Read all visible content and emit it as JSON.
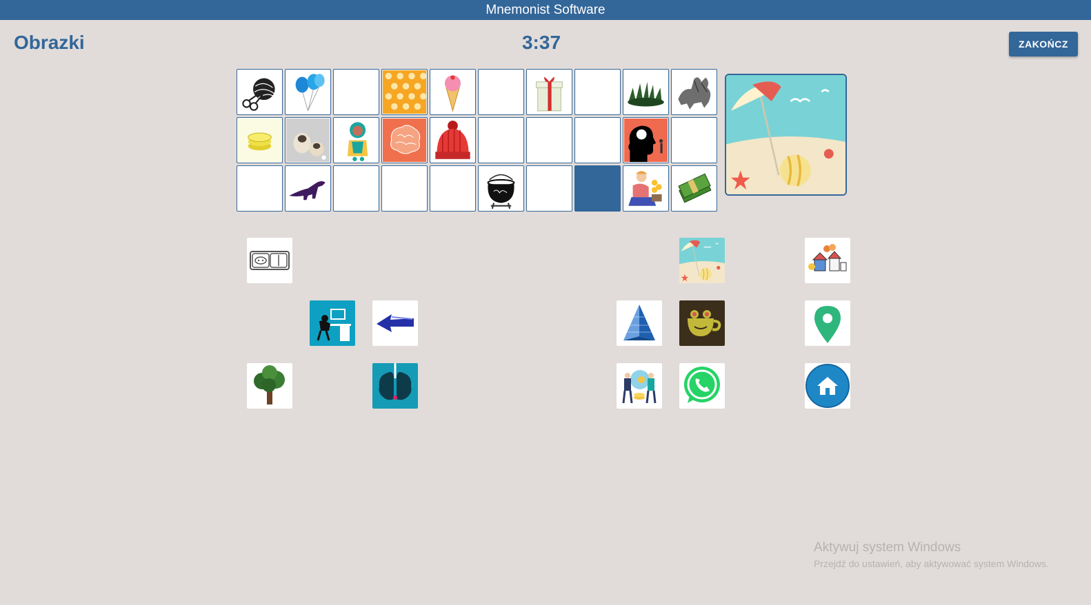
{
  "app": {
    "title": "Mnemonist Software"
  },
  "header": {
    "section_title": "Obrazki",
    "timer": "3:37",
    "finish_label": "ZAKOŃCZ"
  },
  "colors": {
    "primary": "#336699",
    "background": "#e1dcd9"
  },
  "grid": {
    "rows": [
      [
        "yarn-scissors",
        "balloons",
        "empty",
        "orange-dots",
        "ice-cream-cone",
        "empty",
        "gift-box",
        "empty",
        "grass-bush",
        "griffin"
      ],
      [
        "gold-coins",
        "pug-dogs",
        "cartoon-kid",
        "brain",
        "red-winter-hat",
        "empty",
        "empty",
        "empty",
        "head-brain-silhouette",
        "empty"
      ],
      [
        "empty",
        "dinosaur",
        "empty",
        "empty",
        "empty",
        "cauldron",
        "empty",
        "selected",
        "gardener-flowers",
        "money-bundle"
      ]
    ]
  },
  "preview": {
    "image": "beach-umbrella-ball"
  },
  "choices": {
    "left": [
      "power-socket",
      "tired-office-worker",
      "blue-left-arrow",
      "tree",
      "brain-lightning"
    ],
    "right": [
      "beach-umbrella-ball",
      "village-houses",
      "blue-pyramid",
      "frog-teacup",
      "map-pin",
      "business-people-coins",
      "whatsapp-logo",
      "home-button"
    ]
  },
  "watermark": {
    "title": "Aktywuj system Windows",
    "subtitle": "Przejdź do ustawień, aby aktywować system Windows."
  }
}
